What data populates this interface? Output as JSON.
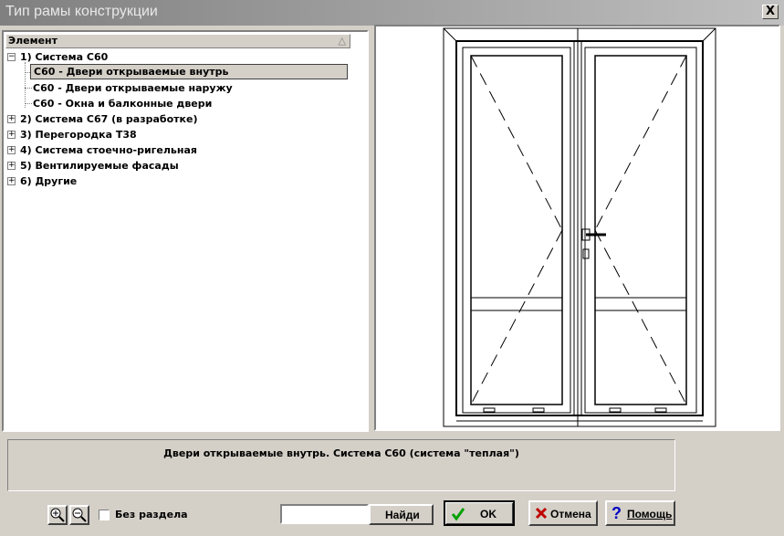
{
  "window": {
    "title": "Тип рамы конструкции",
    "close_label": "X"
  },
  "tree": {
    "header": "Элемент",
    "sort_glyph": "△",
    "items": [
      {
        "label": "1) Система С60",
        "expander": "−"
      },
      {
        "label": "С60 - Двери открываемые внутрь",
        "selected": true
      },
      {
        "label": "С60 - Двери открываемые наружу"
      },
      {
        "label": "С60 - Окна и балконные двери"
      },
      {
        "label": "2) Система С67 (в разработке)",
        "expander": "+"
      },
      {
        "label": "3) Перегородка Т38",
        "expander": "+"
      },
      {
        "label": "4) Система стоечно-ригельная",
        "expander": "+"
      },
      {
        "label": "5) Вентилируемые фасады",
        "expander": "+"
      },
      {
        "label": "6) Другие",
        "expander": "+"
      }
    ]
  },
  "description": "Двери открываемые внутрь. Система С60 (система \"теплая\")",
  "bottom": {
    "zoom_in_icon": "zoom-in-icon",
    "zoom_out_icon": "zoom-out-icon",
    "no_section_label": "Без раздела",
    "no_section_checked": false,
    "search_value": "",
    "find_label": "Найди",
    "ok_label": "OK",
    "cancel_label": "Отмена",
    "help_label": "Помощь"
  },
  "colors": {
    "ok_check": "#00a000",
    "cancel_x": "#c00000",
    "help_q": "#0000c0"
  }
}
